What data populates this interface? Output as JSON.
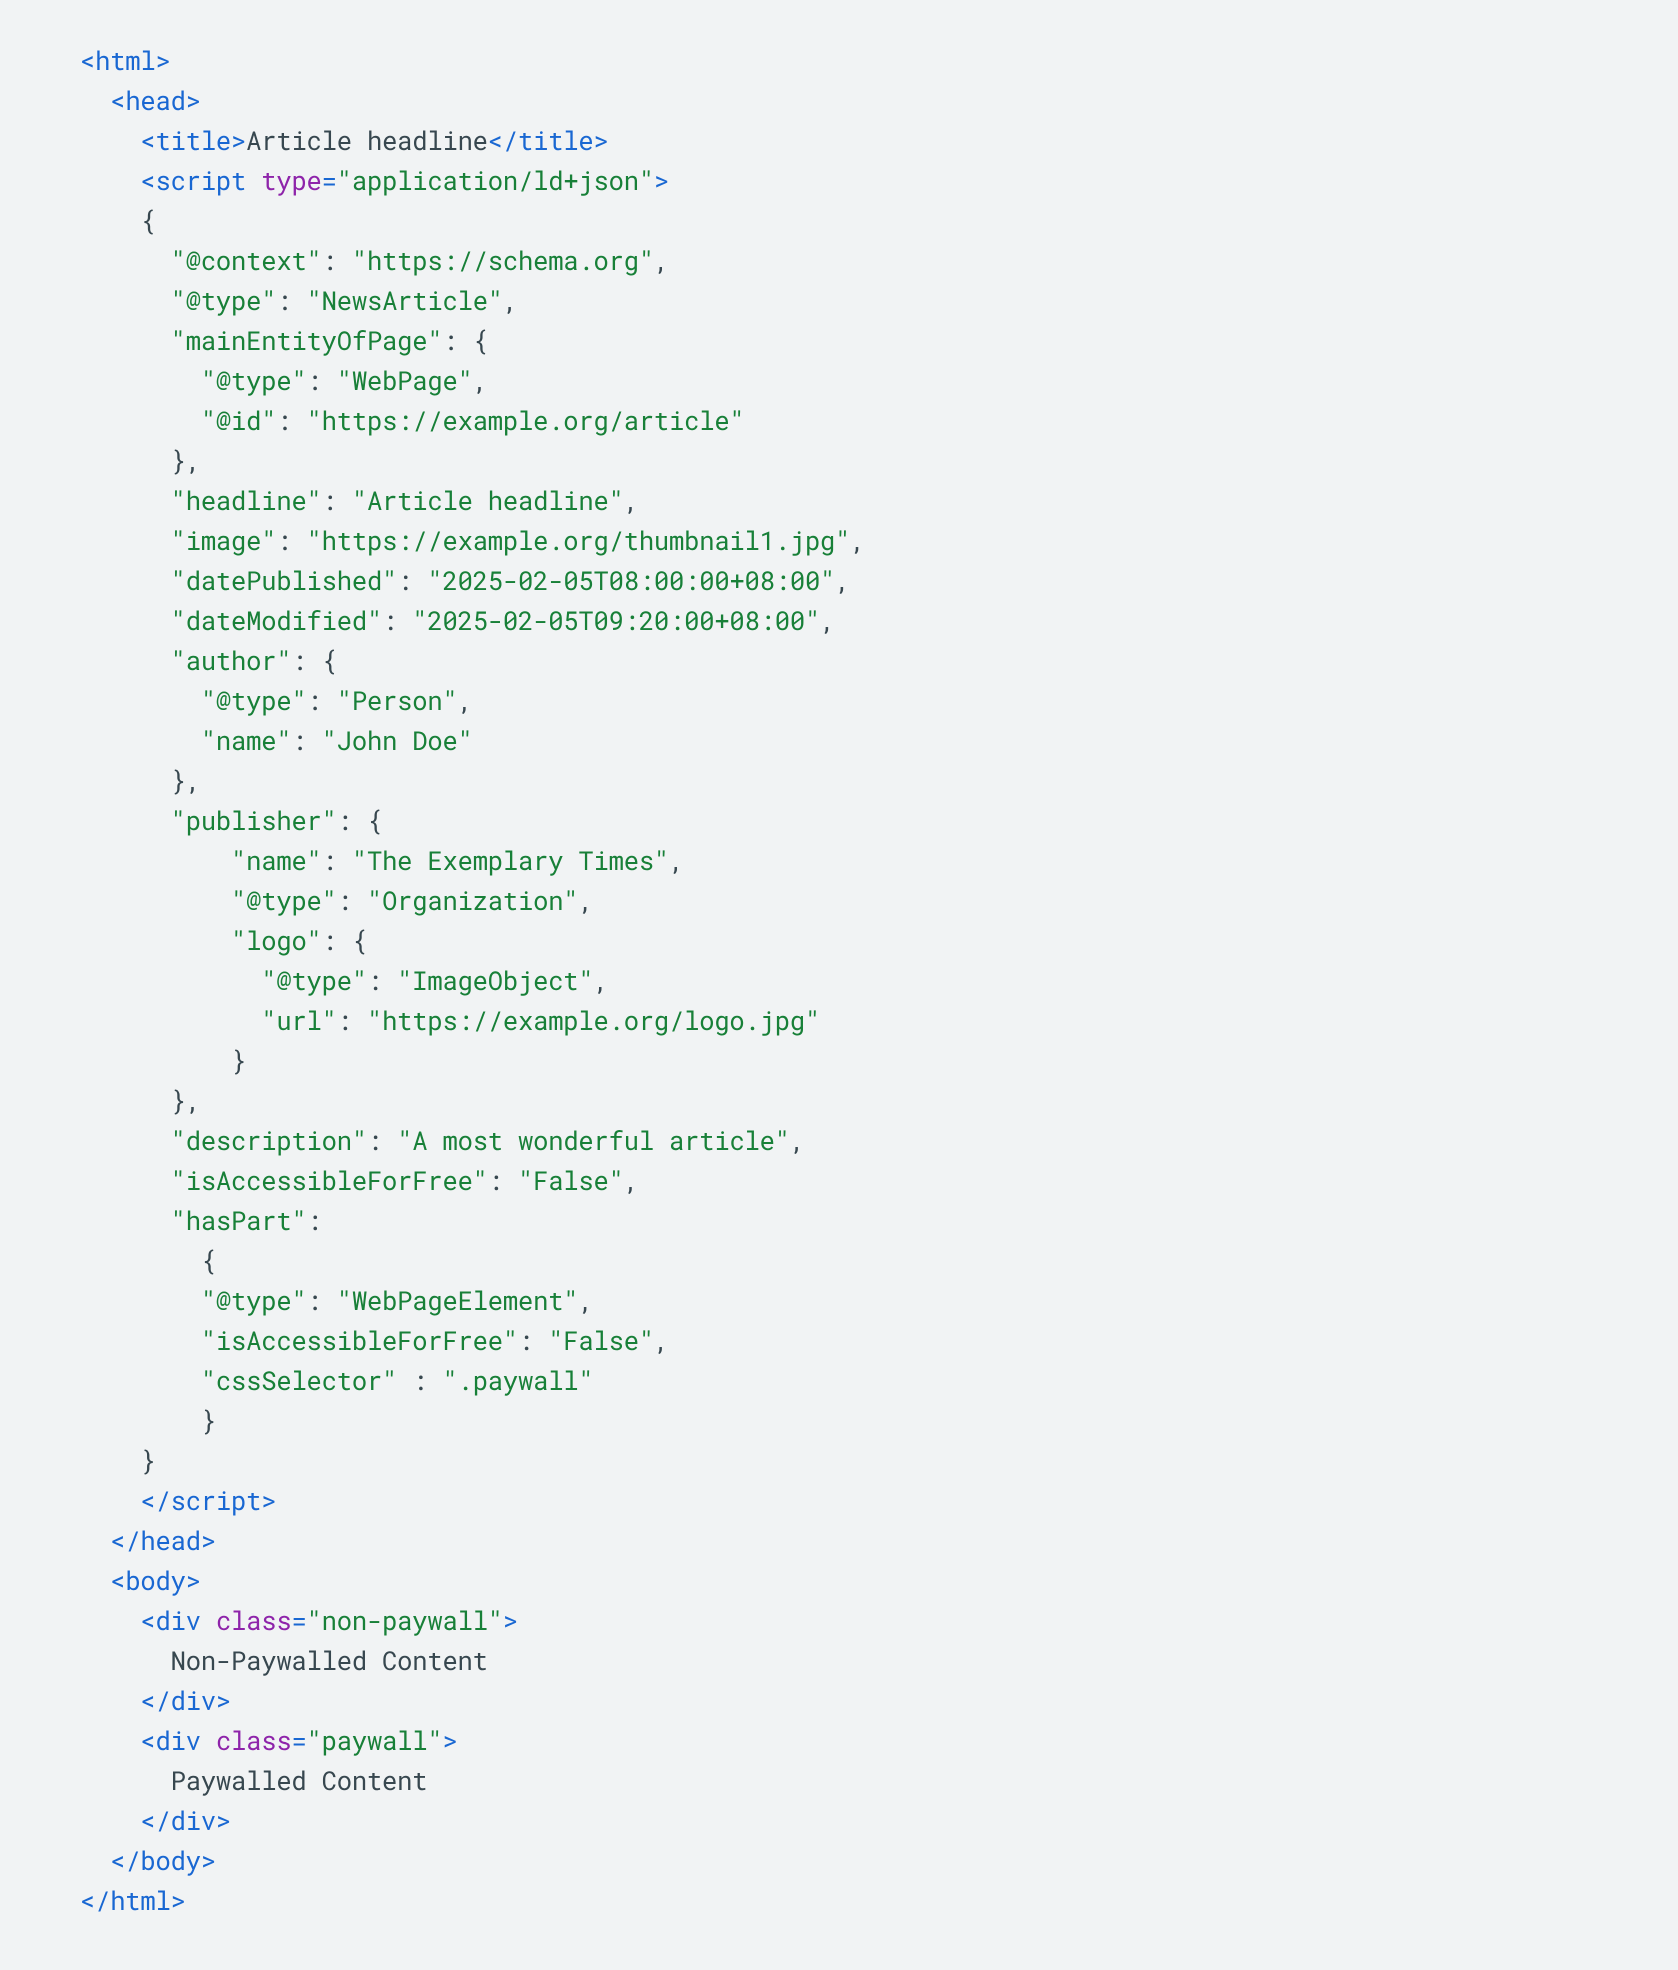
{
  "code": {
    "tokens": [
      {
        "cls": "tag",
        "t": "<html>"
      },
      {
        "cls": "plain",
        "t": "\n  "
      },
      {
        "cls": "tag",
        "t": "<head>"
      },
      {
        "cls": "plain",
        "t": "\n    "
      },
      {
        "cls": "tag",
        "t": "<title>"
      },
      {
        "cls": "plain",
        "t": "Article headline"
      },
      {
        "cls": "tag",
        "t": "</title>"
      },
      {
        "cls": "plain",
        "t": "\n    "
      },
      {
        "cls": "tag",
        "t": "<script "
      },
      {
        "cls": "attr",
        "t": "type"
      },
      {
        "cls": "tag",
        "t": "="
      },
      {
        "cls": "val",
        "t": "\"application/ld+json\""
      },
      {
        "cls": "tag",
        "t": ">"
      },
      {
        "cls": "plain",
        "t": "\n    {\n      "
      },
      {
        "cls": "val",
        "t": "\"@context\""
      },
      {
        "cls": "plain",
        "t": ": "
      },
      {
        "cls": "val",
        "t": "\"https://schema.org\""
      },
      {
        "cls": "plain",
        "t": ",\n      "
      },
      {
        "cls": "val",
        "t": "\"@type\""
      },
      {
        "cls": "plain",
        "t": ": "
      },
      {
        "cls": "val",
        "t": "\"NewsArticle\""
      },
      {
        "cls": "plain",
        "t": ",\n      "
      },
      {
        "cls": "val",
        "t": "\"mainEntityOfPage\""
      },
      {
        "cls": "plain",
        "t": ": {\n        "
      },
      {
        "cls": "val",
        "t": "\"@type\""
      },
      {
        "cls": "plain",
        "t": ": "
      },
      {
        "cls": "val",
        "t": "\"WebPage\""
      },
      {
        "cls": "plain",
        "t": ",\n        "
      },
      {
        "cls": "val",
        "t": "\"@id\""
      },
      {
        "cls": "plain",
        "t": ": "
      },
      {
        "cls": "val",
        "t": "\"https://example.org/article\""
      },
      {
        "cls": "plain",
        "t": "\n      },\n      "
      },
      {
        "cls": "val",
        "t": "\"headline\""
      },
      {
        "cls": "plain",
        "t": ": "
      },
      {
        "cls": "val",
        "t": "\"Article headline\""
      },
      {
        "cls": "plain",
        "t": ",\n      "
      },
      {
        "cls": "val",
        "t": "\"image\""
      },
      {
        "cls": "plain",
        "t": ": "
      },
      {
        "cls": "val",
        "t": "\"https://example.org/thumbnail1.jpg\""
      },
      {
        "cls": "plain",
        "t": ",\n      "
      },
      {
        "cls": "val",
        "t": "\"datePublished\""
      },
      {
        "cls": "plain",
        "t": ": "
      },
      {
        "cls": "val",
        "t": "\"2025-02-05T08:00:00+08:00\""
      },
      {
        "cls": "plain",
        "t": ",\n      "
      },
      {
        "cls": "val",
        "t": "\"dateModified\""
      },
      {
        "cls": "plain",
        "t": ": "
      },
      {
        "cls": "val",
        "t": "\"2025-02-05T09:20:00+08:00\""
      },
      {
        "cls": "plain",
        "t": ",\n      "
      },
      {
        "cls": "val",
        "t": "\"author\""
      },
      {
        "cls": "plain",
        "t": ": {\n        "
      },
      {
        "cls": "val",
        "t": "\"@type\""
      },
      {
        "cls": "plain",
        "t": ": "
      },
      {
        "cls": "val",
        "t": "\"Person\""
      },
      {
        "cls": "plain",
        "t": ",\n        "
      },
      {
        "cls": "val",
        "t": "\"name\""
      },
      {
        "cls": "plain",
        "t": ": "
      },
      {
        "cls": "val",
        "t": "\"John Doe\""
      },
      {
        "cls": "plain",
        "t": "\n      },\n      "
      },
      {
        "cls": "val",
        "t": "\"publisher\""
      },
      {
        "cls": "plain",
        "t": ": {\n          "
      },
      {
        "cls": "val",
        "t": "\"name\""
      },
      {
        "cls": "plain",
        "t": ": "
      },
      {
        "cls": "val",
        "t": "\"The Exemplary Times\""
      },
      {
        "cls": "plain",
        "t": ",\n          "
      },
      {
        "cls": "val",
        "t": "\"@type\""
      },
      {
        "cls": "plain",
        "t": ": "
      },
      {
        "cls": "val",
        "t": "\"Organization\""
      },
      {
        "cls": "plain",
        "t": ",\n          "
      },
      {
        "cls": "val",
        "t": "\"logo\""
      },
      {
        "cls": "plain",
        "t": ": {\n            "
      },
      {
        "cls": "val",
        "t": "\"@type\""
      },
      {
        "cls": "plain",
        "t": ": "
      },
      {
        "cls": "val",
        "t": "\"ImageObject\""
      },
      {
        "cls": "plain",
        "t": ",\n            "
      },
      {
        "cls": "val",
        "t": "\"url\""
      },
      {
        "cls": "plain",
        "t": ": "
      },
      {
        "cls": "val",
        "t": "\"https://example.org/logo.jpg\""
      },
      {
        "cls": "plain",
        "t": "\n          }\n      },\n      "
      },
      {
        "cls": "val",
        "t": "\"description\""
      },
      {
        "cls": "plain",
        "t": ": "
      },
      {
        "cls": "val",
        "t": "\"A most wonderful article\""
      },
      {
        "cls": "plain",
        "t": ",\n      "
      },
      {
        "cls": "val",
        "t": "\"isAccessibleForFree\""
      },
      {
        "cls": "plain",
        "t": ": "
      },
      {
        "cls": "val",
        "t": "\"False\""
      },
      {
        "cls": "plain",
        "t": ",\n      "
      },
      {
        "cls": "val",
        "t": "\"hasPart\""
      },
      {
        "cls": "plain",
        "t": ":\n        {\n        "
      },
      {
        "cls": "val",
        "t": "\"@type\""
      },
      {
        "cls": "plain",
        "t": ": "
      },
      {
        "cls": "val",
        "t": "\"WebPageElement\""
      },
      {
        "cls": "plain",
        "t": ",\n        "
      },
      {
        "cls": "val",
        "t": "\"isAccessibleForFree\""
      },
      {
        "cls": "plain",
        "t": ": "
      },
      {
        "cls": "val",
        "t": "\"False\""
      },
      {
        "cls": "plain",
        "t": ",\n        "
      },
      {
        "cls": "val",
        "t": "\"cssSelector\""
      },
      {
        "cls": "plain",
        "t": " : "
      },
      {
        "cls": "val",
        "t": "\".paywall\""
      },
      {
        "cls": "plain",
        "t": "\n        }\n    }\n    "
      },
      {
        "cls": "tag",
        "t": "</script>"
      },
      {
        "cls": "plain",
        "t": "\n  "
      },
      {
        "cls": "tag",
        "t": "</head>"
      },
      {
        "cls": "plain",
        "t": "\n  "
      },
      {
        "cls": "tag",
        "t": "<body>"
      },
      {
        "cls": "plain",
        "t": "\n    "
      },
      {
        "cls": "tag",
        "t": "<div "
      },
      {
        "cls": "attr",
        "t": "class"
      },
      {
        "cls": "tag",
        "t": "="
      },
      {
        "cls": "val",
        "t": "\"non-paywall\""
      },
      {
        "cls": "tag",
        "t": ">"
      },
      {
        "cls": "plain",
        "t": "\n      Non-Paywalled Content\n    "
      },
      {
        "cls": "tag",
        "t": "</div>"
      },
      {
        "cls": "plain",
        "t": "\n    "
      },
      {
        "cls": "tag",
        "t": "<div "
      },
      {
        "cls": "attr",
        "t": "class"
      },
      {
        "cls": "tag",
        "t": "="
      },
      {
        "cls": "val",
        "t": "\"paywall\""
      },
      {
        "cls": "tag",
        "t": ">"
      },
      {
        "cls": "plain",
        "t": "\n      Paywalled Content\n    "
      },
      {
        "cls": "tag",
        "t": "</div>"
      },
      {
        "cls": "plain",
        "t": "\n  "
      },
      {
        "cls": "tag",
        "t": "</body>"
      },
      {
        "cls": "plain",
        "t": "\n"
      },
      {
        "cls": "tag",
        "t": "</html>"
      }
    ]
  }
}
